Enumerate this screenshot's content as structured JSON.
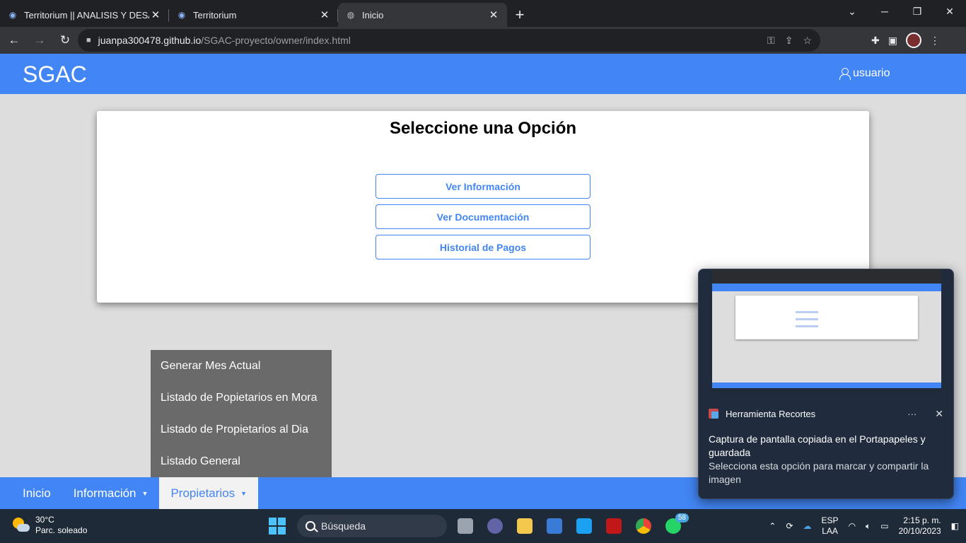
{
  "browser": {
    "tabs": [
      {
        "title": "Territorium || ANALISIS Y DESARR",
        "icon": "eye-icon",
        "active": false
      },
      {
        "title": "Territorium",
        "icon": "eye-icon",
        "active": false
      },
      {
        "title": "Inicio",
        "icon": "globe-icon",
        "active": true
      }
    ],
    "url_host": "juanpa300478.github.io",
    "url_path": "/SGAC-proyecto/owner/index.html"
  },
  "app": {
    "brand": "SGAC",
    "user_label": "usuario",
    "card_title": "Seleccione una Opción",
    "options": [
      "Ver Información",
      "Ver Documentación",
      "Historial de Pagos"
    ],
    "dropdown_items": [
      "Generar Mes Actual",
      "Listado de Popietarios en Mora",
      "Listado de Propietarios al Dia",
      "Listado General"
    ],
    "bottom_nav": [
      {
        "label": "Inicio",
        "caret": ""
      },
      {
        "label": "Información",
        "caret": "▼"
      },
      {
        "label": "Propietarios",
        "caret": "▼",
        "active": true
      }
    ],
    "accent_color": "#4285f4"
  },
  "toast": {
    "app_name": "Herramienta Recortes",
    "message": "Captura de pantalla copiada en el Portapapeles y guardada",
    "sub_message": "Selecciona esta opción para marcar y compartir la imagen"
  },
  "taskbar": {
    "temperature": "30°C",
    "weather": "Parc. soleado",
    "search_placeholder": "Búsqueda",
    "whatsapp_badge": "58",
    "lang_primary": "ESP",
    "lang_secondary": "LAA",
    "time": "2:15 p. m.",
    "date": "20/10/2023"
  }
}
